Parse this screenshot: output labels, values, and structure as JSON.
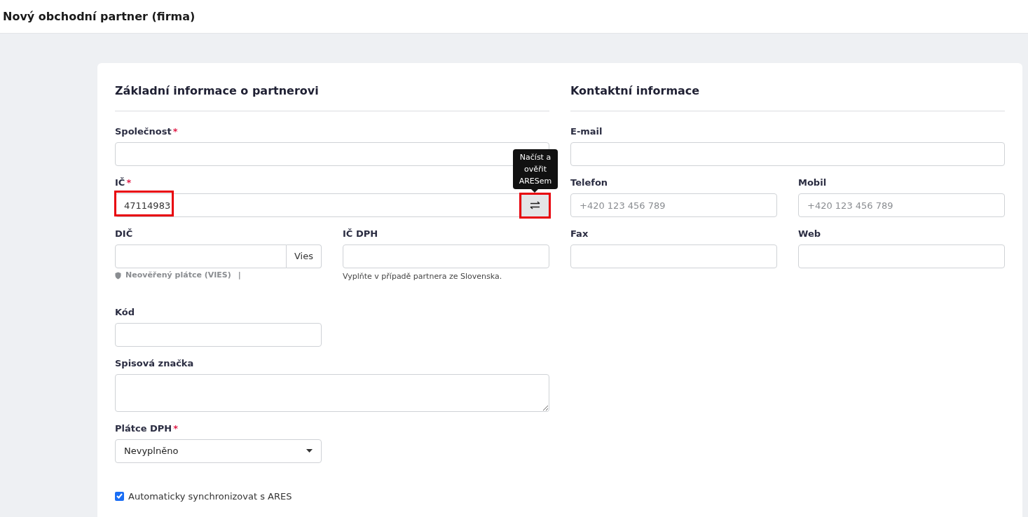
{
  "page_title": "Nový obchodní partner (firma)",
  "basic": {
    "title": "Základní informace o partnerovi",
    "company": {
      "label": "Společnost",
      "required_mark": "*"
    },
    "ic": {
      "label": "IČ",
      "required_mark": "*",
      "value": "47114983",
      "highlighted": true,
      "button_highlighted": true,
      "tooltip": "Načíst a ověřit ARESem"
    },
    "dic": {
      "label": "DIČ",
      "button": "Vies",
      "status": "Neověřený plátce (VIES)",
      "separator": "|"
    },
    "ic_dph": {
      "label": "IČ DPH",
      "hint": "Vyplňte v případě partnera ze Slovenska."
    },
    "code": {
      "label": "Kód"
    },
    "file_number": {
      "label": "Spisová značka"
    },
    "vat_payer": {
      "label": "Plátce DPH",
      "required_mark": "*",
      "value": "Nevyplněno"
    },
    "sync": {
      "label": "Automaticky synchronizovat s ARES",
      "checked": true
    }
  },
  "contact": {
    "title": "Kontaktní informace",
    "fields": [
      {
        "label": "E-mail",
        "wide": true
      },
      {
        "label": "Telefon",
        "placeholder": "+420 123 456 789",
        "wide": false
      },
      {
        "label": "Mobil",
        "placeholder": "+420 123 456 789",
        "wide": false
      },
      {
        "label": "Fax",
        "wide": false
      },
      {
        "label": "Web",
        "wide": false
      }
    ]
  }
}
